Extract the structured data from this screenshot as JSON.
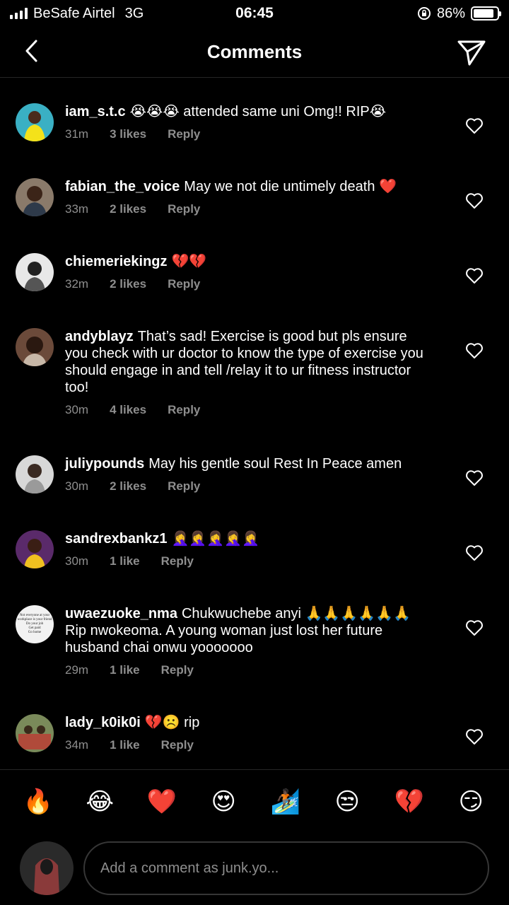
{
  "status": {
    "carrier": "BeSafe Airtel",
    "network": "3G",
    "time": "06:45",
    "battery": "86%",
    "battery_level": 0.86
  },
  "header": {
    "title": "Comments"
  },
  "comments": [
    {
      "user": "iam_s.t.c",
      "text": "😭😭😭 attended same uni Omg!! RIP😭",
      "time": "31m",
      "likes": "3 likes",
      "reply": "Reply"
    },
    {
      "user": "fabian_the_voice",
      "text": "May we not die untimely death ❤️",
      "time": "33m",
      "likes": "2 likes",
      "reply": "Reply"
    },
    {
      "user": "chiemeriekingz",
      "text": "💔💔",
      "time": "32m",
      "likes": "2 likes",
      "reply": "Reply"
    },
    {
      "user": "andyblayz",
      "text": "That’s sad! Exercise is good but pls ensure you check with ur doctor to know the type of exercise you should engage in and tell /relay it to ur fitness instructor too!",
      "time": "30m",
      "likes": "4 likes",
      "reply": "Reply"
    },
    {
      "user": "juliypounds",
      "text": "May his gentle soul Rest In Peace amen",
      "time": "30m",
      "likes": "2 likes",
      "reply": "Reply"
    },
    {
      "user": "sandrexbankz1",
      "text": "🤦‍♀️🤦‍♀️🤦‍♀️🤦‍♀️🤦‍♀️",
      "time": "30m",
      "likes": "1 like",
      "reply": "Reply"
    },
    {
      "user": "uwaezuoke_nma",
      "text": "Chukwuchebe anyi 🙏🙏🙏🙏🙏🙏 Rip nwokeoma. A young woman just lost her future husband chai onwu yooooooo",
      "time": "29m",
      "likes": "1 like",
      "reply": "Reply"
    },
    {
      "user": "lady_k0ik0i",
      "text": "💔☹️ rip",
      "time": "34m",
      "likes": "1 like",
      "reply": "Reply"
    }
  ],
  "avatar_texts": {
    "uwaezuoke_nma": [
      "Not everyone at your",
      "workplace is your friend",
      "Do your job",
      "Get paid",
      "Go home"
    ]
  },
  "emoji_bar": [
    "🔥",
    "😂",
    "❤️",
    "😍",
    "🏄🏿",
    "😒",
    "💔",
    "😏"
  ],
  "input": {
    "placeholder": "Add a comment as junk.yo..."
  },
  "colors": {
    "background": "#000000",
    "secondary_text": "#8e8e8e",
    "divider": "#262626"
  }
}
